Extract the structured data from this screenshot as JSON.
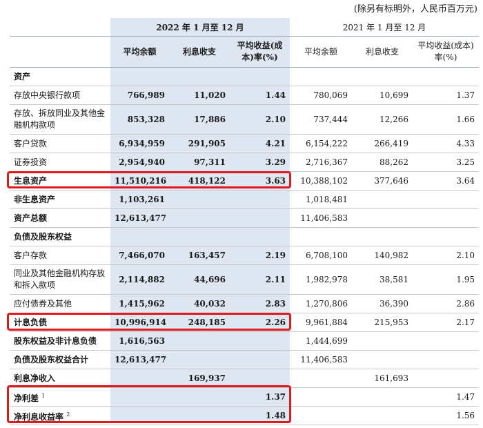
{
  "unit_note": "(除另有标明外，人民币百万元)",
  "header": {
    "period_current": "2022 年 1 月至 12 月",
    "period_previous": "2021 年 1 月至 12 月",
    "cols_current": [
      "平均余额",
      "利息收支",
      "平均收益(成本)率(%)"
    ],
    "cols_previous": [
      "平均余额",
      "利息收支",
      "平均收益(成本)率(%)"
    ]
  },
  "rows": [
    {
      "label": "资产",
      "bold": true,
      "values": [
        "",
        "",
        "",
        "",
        "",
        ""
      ]
    },
    {
      "label": "存放中央银行款项",
      "bold": false,
      "values": [
        "766,989",
        "11,020",
        "1.44",
        "780,069",
        "10,699",
        "1.37"
      ]
    },
    {
      "label": "存放、拆放同业及其他金融机构款项",
      "bold": false,
      "values": [
        "853,328",
        "17,886",
        "2.10",
        "737,444",
        "12,266",
        "1.66"
      ]
    },
    {
      "label": "客户贷款",
      "bold": false,
      "values": [
        "6,934,959",
        "291,905",
        "4.21",
        "6,154,222",
        "266,419",
        "4.33"
      ]
    },
    {
      "label": "证券投资",
      "bold": false,
      "values": [
        "2,954,940",
        "97,311",
        "3.29",
        "2,716,367",
        "88,262",
        "3.25"
      ]
    },
    {
      "label": "生息资产",
      "bold": true,
      "values": [
        "11,510,216",
        "418,122",
        "3.63",
        "10,388,102",
        "377,646",
        "3.64"
      ]
    },
    {
      "label": "非生息资产",
      "bold": true,
      "values": [
        "1,103,261",
        "",
        "",
        "1,018,481",
        "",
        ""
      ]
    },
    {
      "label": "资产总额",
      "bold": true,
      "values": [
        "12,613,477",
        "",
        "",
        "11,406,583",
        "",
        ""
      ]
    },
    {
      "label": "负债及股东权益",
      "bold": true,
      "values": [
        "",
        "",
        "",
        "",
        "",
        ""
      ]
    },
    {
      "label": "客户存款",
      "bold": false,
      "values": [
        "7,466,070",
        "163,457",
        "2.19",
        "6,708,100",
        "140,982",
        "2.10"
      ]
    },
    {
      "label": "同业及其他金融机构存放和拆入款项",
      "bold": false,
      "values": [
        "2,114,882",
        "44,696",
        "2.11",
        "1,982,978",
        "38,581",
        "1.95"
      ]
    },
    {
      "label": "应付债券及其他",
      "bold": false,
      "values": [
        "1,415,962",
        "40,032",
        "2.83",
        "1,270,806",
        "36,390",
        "2.86"
      ]
    },
    {
      "label": "计息负债",
      "bold": true,
      "values": [
        "10,996,914",
        "248,185",
        "2.26",
        "9,961,884",
        "215,953",
        "2.17"
      ]
    },
    {
      "label": "股东权益及非计息负债",
      "bold": true,
      "values": [
        "1,616,563",
        "",
        "",
        "1,444,699",
        "",
        ""
      ]
    },
    {
      "label": "负债及股东权益合计",
      "bold": true,
      "values": [
        "12,613,477",
        "",
        "",
        "11,406,583",
        "",
        ""
      ]
    },
    {
      "label": "利息净收入",
      "bold": true,
      "values": [
        "",
        "169,937",
        "",
        "",
        "161,693",
        ""
      ]
    },
    {
      "label": "净利差",
      "sup": "1",
      "bold": true,
      "values": [
        "",
        "",
        "1.37",
        "",
        "",
        "1.47"
      ]
    },
    {
      "label": "净利息收益率",
      "sup": "2",
      "bold": true,
      "values": [
        "",
        "",
        "1.48",
        "",
        "",
        "1.56"
      ]
    }
  ],
  "colors": {
    "highlight": "#e0191e",
    "current_period_shade": "#dde6f1"
  }
}
